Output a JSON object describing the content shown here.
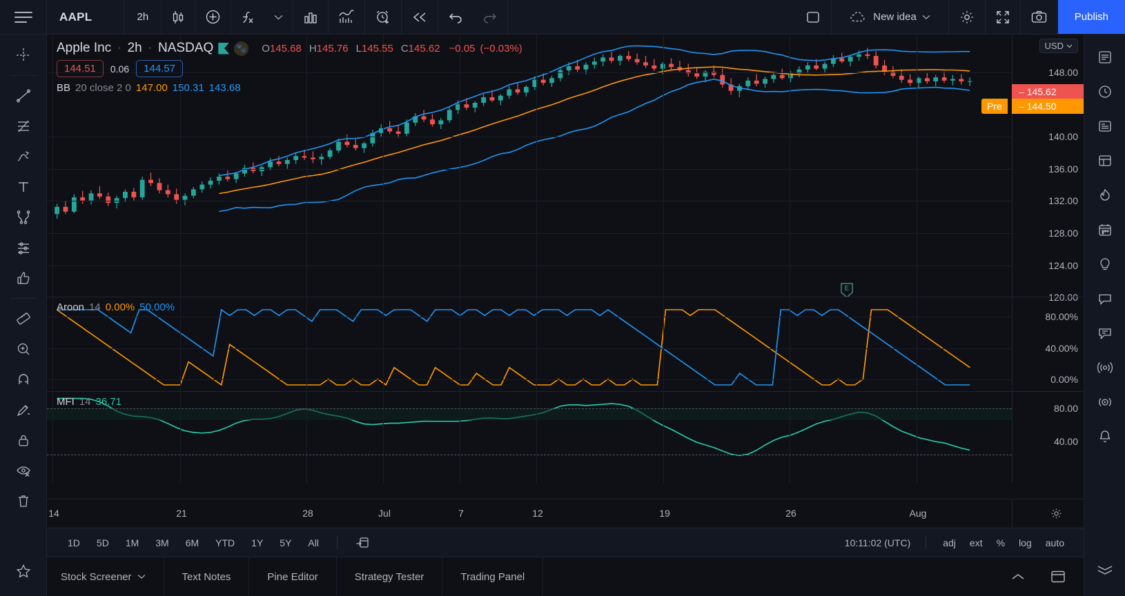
{
  "toolbar": {
    "menu_icon": "hamburger-icon",
    "symbol": "AAPL",
    "interval": "2h",
    "candles_icon": "candlestick-style-icon",
    "add_icon": "plus-circle-icon",
    "indicators_icon": "fx-indicators-icon",
    "chevron_icon": "chevron-down-icon",
    "bars_icon": "bar-pattern-icon",
    "compare_icon": "compare-icon",
    "alert_icon": "alarm-clock-plus-icon",
    "replay_icon": "rewind-replay-icon",
    "undo_icon": "undo-icon",
    "redo_icon": "redo-icon",
    "layout_icon": "single-layout-icon",
    "new_idea_label": "New idea",
    "new_idea_icon": "cloud-dashed-icon",
    "settings_icon": "gear-icon",
    "fullscreen_icon": "fullscreen-icon",
    "snapshot_icon": "camera-icon",
    "publish_label": "Publish"
  },
  "left_tools": [
    {
      "name": "crosshair-cursor-icon"
    },
    {
      "name": "trend-line-icon"
    },
    {
      "name": "fib-retracement-icon"
    },
    {
      "name": "brush-icon"
    },
    {
      "name": "text-tool-icon"
    },
    {
      "name": "pattern-icon"
    },
    {
      "name": "forecast-icon"
    },
    {
      "name": "thumbs-up-icon"
    },
    {
      "name": "measure-ruler-icon"
    },
    {
      "name": "zoom-in-icon"
    },
    {
      "name": "magnet-icon"
    },
    {
      "name": "drawing-mode-icon"
    },
    {
      "name": "lock-drawings-icon"
    },
    {
      "name": "hide-drawings-icon"
    },
    {
      "name": "remove-drawings-icon"
    },
    {
      "name": "favorites-star-icon"
    }
  ],
  "right_tools": [
    {
      "name": "watchlist-icon"
    },
    {
      "name": "alerts-clock-icon"
    },
    {
      "name": "news-icon"
    },
    {
      "name": "data-window-icon"
    },
    {
      "name": "hotlist-icon"
    },
    {
      "name": "calendar-icon"
    },
    {
      "name": "ideas-icon"
    },
    {
      "name": "chat-public-icon"
    },
    {
      "name": "private-chat-icon"
    },
    {
      "name": "broker-icon"
    },
    {
      "name": "stream-icon"
    },
    {
      "name": "notifications-bell-icon"
    },
    {
      "name": "objects-tree-icon"
    }
  ],
  "legend": {
    "company": "Apple Inc",
    "interval": "2h",
    "exchange": "NASDAQ",
    "flag_icon": "green-flag-icon",
    "paw_icon": "paw-badge-icon",
    "ohlc": {
      "o_label": "O",
      "o_value": "145.68",
      "h_label": "H",
      "h_value": "145.76",
      "l_label": "L",
      "l_value": "145.55",
      "c_label": "C",
      "c_value": "145.62",
      "change": "−0.05",
      "change_pct": "(−0.03%)"
    },
    "bid": "144.51",
    "spread": "0.06",
    "ask": "144.57",
    "bb": {
      "name": "BB",
      "args": "20 close 2 0",
      "basis": "147.00",
      "upper": "150.31",
      "lower": "143.68"
    }
  },
  "aroon": {
    "name": "Aroon",
    "args": "14",
    "down_value": "0.00%",
    "up_value": "50.00%",
    "scale": [
      "80.00%",
      "40.00%",
      "0.00%"
    ]
  },
  "mfi": {
    "name": "MFI",
    "args": "14",
    "value": "36.71",
    "scale": [
      "80.00",
      "40.00"
    ]
  },
  "price_scale": {
    "currency": "USD",
    "currency_chevron": "chevron-down-icon",
    "ticks": [
      "148.00",
      "140.00",
      "136.00",
      "132.00",
      "128.00",
      "124.00",
      "120.00"
    ],
    "last_price": "145.62",
    "pre_price": "144.50",
    "pre_label": "Pre",
    "gear_icon": "gear-icon"
  },
  "time_axis": {
    "labels": [
      "14",
      "21",
      "28",
      "Jul",
      "7",
      "12",
      "19",
      "26",
      "Aug"
    ]
  },
  "bottom_bar": {
    "ranges": [
      "1D",
      "5D",
      "1M",
      "3M",
      "6M",
      "YTD",
      "1Y",
      "5Y",
      "All"
    ],
    "goto_icon": "go-to-date-icon",
    "clock": "10:11:02 (UTC)",
    "options": [
      "adj",
      "ext",
      "%",
      "log",
      "auto"
    ]
  },
  "footer": {
    "tabs": [
      {
        "label": "Stock Screener",
        "icon": "chevron-down-icon"
      },
      {
        "label": "Text Notes",
        "icon": ""
      },
      {
        "label": "Pine Editor",
        "icon": ""
      },
      {
        "label": "Strategy Tester",
        "icon": ""
      },
      {
        "label": "Trading Panel",
        "icon": ""
      }
    ],
    "collapse_icon": "chevron-up-icon",
    "panel_icon": "panel-layout-icon"
  },
  "chart_data": {
    "type": "candlestick",
    "title": "Apple Inc · 2h · NASDAQ",
    "symbol": "AAPL",
    "interval": "2h",
    "ylabel": "USD",
    "ylim": [
      118.5,
      151.5
    ],
    "grid": true,
    "x_tick_labels": [
      "14",
      "21",
      "28",
      "Jul",
      "7",
      "12",
      "19",
      "26",
      "Aug"
    ],
    "y_tick_labels": [
      "148.00",
      "140.00",
      "136.00",
      "132.00",
      "128.00",
      "124.00",
      "120.00"
    ],
    "last_price": 145.62,
    "pre_market_price": 144.5,
    "overlays": [
      {
        "name": "BB upper",
        "color": "#2196f3"
      },
      {
        "name": "BB basis",
        "color": "#ff9800"
      },
      {
        "name": "BB lower",
        "color": "#2196f3"
      }
    ],
    "candles": [
      {
        "o": 128.9,
        "h": 130.2,
        "l": 128.3,
        "c": 129.8
      },
      {
        "o": 129.8,
        "h": 130.6,
        "l": 128.9,
        "c": 129.2
      },
      {
        "o": 129.2,
        "h": 131.4,
        "l": 129.0,
        "c": 131.0
      },
      {
        "o": 131.0,
        "h": 131.8,
        "l": 130.2,
        "c": 130.6
      },
      {
        "o": 130.6,
        "h": 131.9,
        "l": 130.1,
        "c": 131.5
      },
      {
        "o": 131.5,
        "h": 132.4,
        "l": 130.8,
        "c": 131.1
      },
      {
        "o": 131.1,
        "h": 131.6,
        "l": 129.9,
        "c": 130.3
      },
      {
        "o": 130.3,
        "h": 131.2,
        "l": 129.6,
        "c": 130.9
      },
      {
        "o": 130.9,
        "h": 132.0,
        "l": 130.4,
        "c": 131.7
      },
      {
        "o": 131.7,
        "h": 132.2,
        "l": 130.6,
        "c": 131.0
      },
      {
        "o": 131.0,
        "h": 133.6,
        "l": 130.7,
        "c": 133.2
      },
      {
        "o": 133.2,
        "h": 134.1,
        "l": 132.4,
        "c": 132.8
      },
      {
        "o": 132.8,
        "h": 133.4,
        "l": 131.5,
        "c": 131.9
      },
      {
        "o": 131.9,
        "h": 132.6,
        "l": 131.0,
        "c": 131.4
      },
      {
        "o": 131.4,
        "h": 132.1,
        "l": 130.2,
        "c": 130.7
      },
      {
        "o": 130.7,
        "h": 131.5,
        "l": 130.0,
        "c": 131.2
      },
      {
        "o": 131.2,
        "h": 132.3,
        "l": 130.9,
        "c": 132.0
      },
      {
        "o": 132.0,
        "h": 133.0,
        "l": 131.6,
        "c": 132.6
      },
      {
        "o": 132.6,
        "h": 133.5,
        "l": 132.1,
        "c": 133.1
      },
      {
        "o": 133.1,
        "h": 134.0,
        "l": 132.6,
        "c": 133.6
      },
      {
        "o": 133.6,
        "h": 134.4,
        "l": 133.0,
        "c": 133.3
      },
      {
        "o": 133.3,
        "h": 134.2,
        "l": 132.8,
        "c": 134.0
      },
      {
        "o": 134.0,
        "h": 135.1,
        "l": 133.6,
        "c": 134.7
      },
      {
        "o": 134.7,
        "h": 135.4,
        "l": 134.0,
        "c": 134.3
      },
      {
        "o": 134.3,
        "h": 135.0,
        "l": 133.7,
        "c": 134.8
      },
      {
        "o": 134.8,
        "h": 135.9,
        "l": 134.4,
        "c": 135.5
      },
      {
        "o": 135.5,
        "h": 136.2,
        "l": 134.9,
        "c": 135.2
      },
      {
        "o": 135.2,
        "h": 136.0,
        "l": 134.6,
        "c": 135.7
      },
      {
        "o": 135.7,
        "h": 136.6,
        "l": 135.2,
        "c": 136.2
      },
      {
        "o": 136.2,
        "h": 137.0,
        "l": 135.7,
        "c": 136.0
      },
      {
        "o": 136.0,
        "h": 136.8,
        "l": 135.3,
        "c": 135.8
      },
      {
        "o": 135.8,
        "h": 136.5,
        "l": 135.1,
        "c": 136.1
      },
      {
        "o": 136.1,
        "h": 137.2,
        "l": 135.8,
        "c": 136.9
      },
      {
        "o": 136.9,
        "h": 138.4,
        "l": 136.6,
        "c": 138.0
      },
      {
        "o": 138.0,
        "h": 138.9,
        "l": 137.3,
        "c": 137.6
      },
      {
        "o": 137.6,
        "h": 138.3,
        "l": 136.9,
        "c": 137.2
      },
      {
        "o": 137.2,
        "h": 138.0,
        "l": 136.6,
        "c": 137.8
      },
      {
        "o": 137.8,
        "h": 139.5,
        "l": 137.4,
        "c": 139.1
      },
      {
        "o": 139.1,
        "h": 140.2,
        "l": 138.6,
        "c": 139.7
      },
      {
        "o": 139.7,
        "h": 140.6,
        "l": 139.0,
        "c": 139.3
      },
      {
        "o": 139.3,
        "h": 140.1,
        "l": 138.5,
        "c": 139.0
      },
      {
        "o": 139.0,
        "h": 140.8,
        "l": 138.7,
        "c": 140.4
      },
      {
        "o": 140.4,
        "h": 141.6,
        "l": 140.0,
        "c": 141.2
      },
      {
        "o": 141.2,
        "h": 142.0,
        "l": 140.5,
        "c": 140.8
      },
      {
        "o": 140.8,
        "h": 141.5,
        "l": 139.9,
        "c": 140.2
      },
      {
        "o": 140.2,
        "h": 141.0,
        "l": 139.6,
        "c": 140.7
      },
      {
        "o": 140.7,
        "h": 142.3,
        "l": 140.4,
        "c": 142.0
      },
      {
        "o": 142.0,
        "h": 143.2,
        "l": 141.5,
        "c": 142.7
      },
      {
        "o": 142.7,
        "h": 143.5,
        "l": 142.0,
        "c": 142.3
      },
      {
        "o": 142.3,
        "h": 143.1,
        "l": 141.7,
        "c": 142.9
      },
      {
        "o": 142.9,
        "h": 144.0,
        "l": 142.5,
        "c": 143.6
      },
      {
        "o": 143.6,
        "h": 144.5,
        "l": 143.0,
        "c": 143.2
      },
      {
        "o": 143.2,
        "h": 144.0,
        "l": 142.6,
        "c": 143.8
      },
      {
        "o": 143.8,
        "h": 145.0,
        "l": 143.4,
        "c": 144.6
      },
      {
        "o": 144.6,
        "h": 145.4,
        "l": 143.9,
        "c": 144.2
      },
      {
        "o": 144.2,
        "h": 145.1,
        "l": 143.7,
        "c": 144.9
      },
      {
        "o": 144.9,
        "h": 146.2,
        "l": 144.5,
        "c": 145.8
      },
      {
        "o": 145.8,
        "h": 146.6,
        "l": 145.1,
        "c": 145.4
      },
      {
        "o": 145.4,
        "h": 146.3,
        "l": 144.9,
        "c": 146.0
      },
      {
        "o": 146.0,
        "h": 147.4,
        "l": 145.6,
        "c": 147.0
      },
      {
        "o": 147.0,
        "h": 148.0,
        "l": 146.4,
        "c": 147.5
      },
      {
        "o": 147.5,
        "h": 148.3,
        "l": 146.8,
        "c": 147.1
      },
      {
        "o": 147.1,
        "h": 148.0,
        "l": 146.5,
        "c": 147.7
      },
      {
        "o": 147.7,
        "h": 148.6,
        "l": 147.2,
        "c": 148.1
      },
      {
        "o": 148.1,
        "h": 149.0,
        "l": 147.5,
        "c": 148.6
      },
      {
        "o": 148.6,
        "h": 149.3,
        "l": 147.9,
        "c": 148.2
      },
      {
        "o": 148.2,
        "h": 149.0,
        "l": 147.6,
        "c": 148.8
      },
      {
        "o": 148.8,
        "h": 149.4,
        "l": 148.1,
        "c": 148.4
      },
      {
        "o": 148.4,
        "h": 149.1,
        "l": 147.7,
        "c": 148.0
      },
      {
        "o": 148.0,
        "h": 148.8,
        "l": 147.3,
        "c": 147.6
      },
      {
        "o": 147.6,
        "h": 148.4,
        "l": 146.9,
        "c": 147.2
      },
      {
        "o": 147.2,
        "h": 148.0,
        "l": 146.5,
        "c": 147.8
      },
      {
        "o": 147.8,
        "h": 148.5,
        "l": 147.1,
        "c": 147.4
      },
      {
        "o": 147.4,
        "h": 148.2,
        "l": 146.8,
        "c": 147.0
      },
      {
        "o": 147.0,
        "h": 147.8,
        "l": 146.2,
        "c": 146.6
      },
      {
        "o": 146.6,
        "h": 147.4,
        "l": 145.9,
        "c": 146.2
      },
      {
        "o": 146.2,
        "h": 147.0,
        "l": 145.5,
        "c": 146.8
      },
      {
        "o": 146.8,
        "h": 147.6,
        "l": 146.1,
        "c": 146.4
      },
      {
        "o": 146.4,
        "h": 147.2,
        "l": 144.8,
        "c": 145.2
      },
      {
        "o": 145.2,
        "h": 146.0,
        "l": 143.9,
        "c": 144.4
      },
      {
        "o": 144.4,
        "h": 145.3,
        "l": 143.6,
        "c": 145.0
      },
      {
        "o": 145.0,
        "h": 146.1,
        "l": 144.5,
        "c": 145.7
      },
      {
        "o": 145.7,
        "h": 146.5,
        "l": 145.0,
        "c": 145.3
      },
      {
        "o": 145.3,
        "h": 146.2,
        "l": 144.8,
        "c": 145.9
      },
      {
        "o": 145.9,
        "h": 146.8,
        "l": 145.4,
        "c": 146.4
      },
      {
        "o": 146.4,
        "h": 147.2,
        "l": 145.8,
        "c": 146.0
      },
      {
        "o": 146.0,
        "h": 146.9,
        "l": 145.5,
        "c": 146.6
      },
      {
        "o": 146.6,
        "h": 147.5,
        "l": 146.1,
        "c": 147.1
      },
      {
        "o": 147.1,
        "h": 148.0,
        "l": 146.6,
        "c": 147.6
      },
      {
        "o": 147.6,
        "h": 148.4,
        "l": 147.0,
        "c": 147.2
      },
      {
        "o": 147.2,
        "h": 148.1,
        "l": 146.7,
        "c": 147.8
      },
      {
        "o": 147.8,
        "h": 148.9,
        "l": 147.4,
        "c": 148.5
      },
      {
        "o": 148.5,
        "h": 149.2,
        "l": 147.9,
        "c": 148.1
      },
      {
        "o": 148.1,
        "h": 148.9,
        "l": 147.5,
        "c": 148.7
      },
      {
        "o": 148.7,
        "h": 149.5,
        "l": 148.2,
        "c": 149.0
      },
      {
        "o": 149.0,
        "h": 149.8,
        "l": 148.4,
        "c": 148.8
      },
      {
        "o": 148.8,
        "h": 149.4,
        "l": 147.2,
        "c": 147.6
      },
      {
        "o": 147.6,
        "h": 148.3,
        "l": 146.4,
        "c": 146.8
      },
      {
        "o": 146.8,
        "h": 147.5,
        "l": 146.0,
        "c": 146.3
      },
      {
        "o": 146.3,
        "h": 147.0,
        "l": 145.4,
        "c": 145.8
      },
      {
        "o": 145.8,
        "h": 146.5,
        "l": 145.0,
        "c": 145.4
      },
      {
        "o": 145.4,
        "h": 146.2,
        "l": 144.7,
        "c": 146.0
      },
      {
        "o": 146.0,
        "h": 146.7,
        "l": 145.3,
        "c": 145.6
      },
      {
        "o": 145.6,
        "h": 146.4,
        "l": 145.0,
        "c": 146.1
      },
      {
        "o": 146.1,
        "h": 146.8,
        "l": 145.4,
        "c": 145.7
      },
      {
        "o": 145.7,
        "h": 146.4,
        "l": 145.1,
        "c": 145.9
      },
      {
        "o": 145.9,
        "h": 146.5,
        "l": 145.2,
        "c": 145.6
      },
      {
        "o": 145.6,
        "h": 146.1,
        "l": 145.0,
        "c": 145.62
      }
    ]
  }
}
